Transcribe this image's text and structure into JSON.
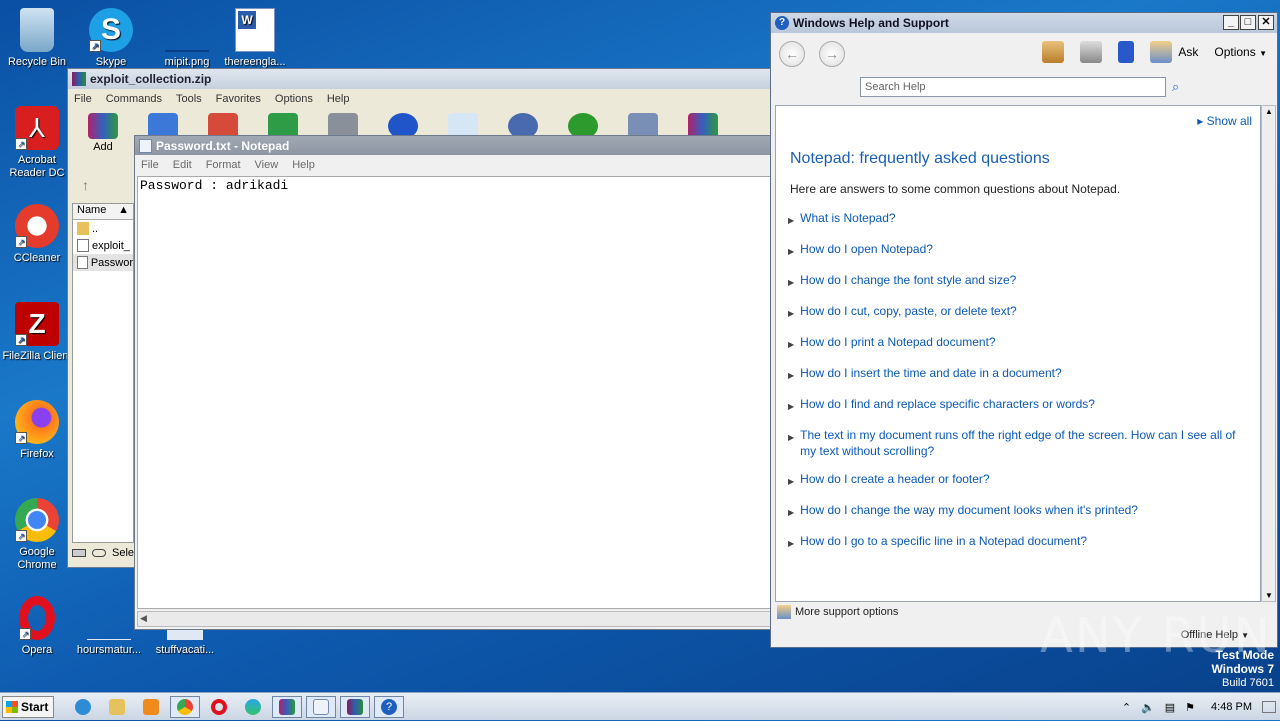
{
  "desktop": {
    "icons": [
      {
        "label": "Recycle Bin"
      },
      {
        "label": "Skype"
      },
      {
        "label": "mipit.png"
      },
      {
        "label": "thereengla..."
      },
      {
        "label": "Acrobat Reader DC"
      },
      {
        "label": "CCleaner"
      },
      {
        "label": "FileZilla Client"
      },
      {
        "label": "Firefox"
      },
      {
        "label": "Google Chrome"
      },
      {
        "label": "Opera"
      },
      {
        "label": "hoursmatur..."
      },
      {
        "label": "stuffvacati..."
      }
    ]
  },
  "winrar": {
    "title": "exploit_collection.zip",
    "menu": [
      "File",
      "Commands",
      "Tools",
      "Favorites",
      "Options",
      "Help"
    ],
    "toolbar": {
      "add_label": "Add"
    },
    "list": {
      "header": "Name",
      "rows": [
        "..",
        "exploit_",
        "Passwor"
      ]
    },
    "status_text": "Sele"
  },
  "notepad": {
    "title": "Password.txt - Notepad",
    "menu": [
      "File",
      "Edit",
      "Format",
      "View",
      "Help"
    ],
    "content": "Password : adrikadi"
  },
  "help": {
    "title": "Windows Help and Support",
    "ask_label": "Ask",
    "options_label": "Options",
    "search_placeholder": "Search Help",
    "show_all": "Show all",
    "heading": "Notepad: frequently asked questions",
    "intro": "Here are answers to some common questions about Notepad.",
    "faqs": [
      "What is Notepad?",
      "How do I open Notepad?",
      "How do I change the font style and size?",
      "How do I cut, copy, paste, or delete text?",
      "How do I print a Notepad document?",
      "How do I insert the time and date in a document?",
      "How do I find and replace specific characters or words?",
      "The text in my document runs off the right edge of the screen. How can I see all of my text without scrolling?",
      "How do I create a header or footer?",
      "How do I change the way my document looks when it's printed?",
      "How do I go to a specific line in a Notepad document?"
    ],
    "footer": "More support options",
    "offline": "Offline Help"
  },
  "watermark": "ANY RUN",
  "testmode": {
    "line1": "Test Mode",
    "line2": "Windows 7",
    "line3": "Build 7601"
  },
  "taskbar": {
    "start_label": "Start",
    "clock": "4:48 PM"
  },
  "colors": {
    "link": "#0b59b5",
    "heading": "#1a5fb4",
    "desktop": "#1a78c9"
  }
}
